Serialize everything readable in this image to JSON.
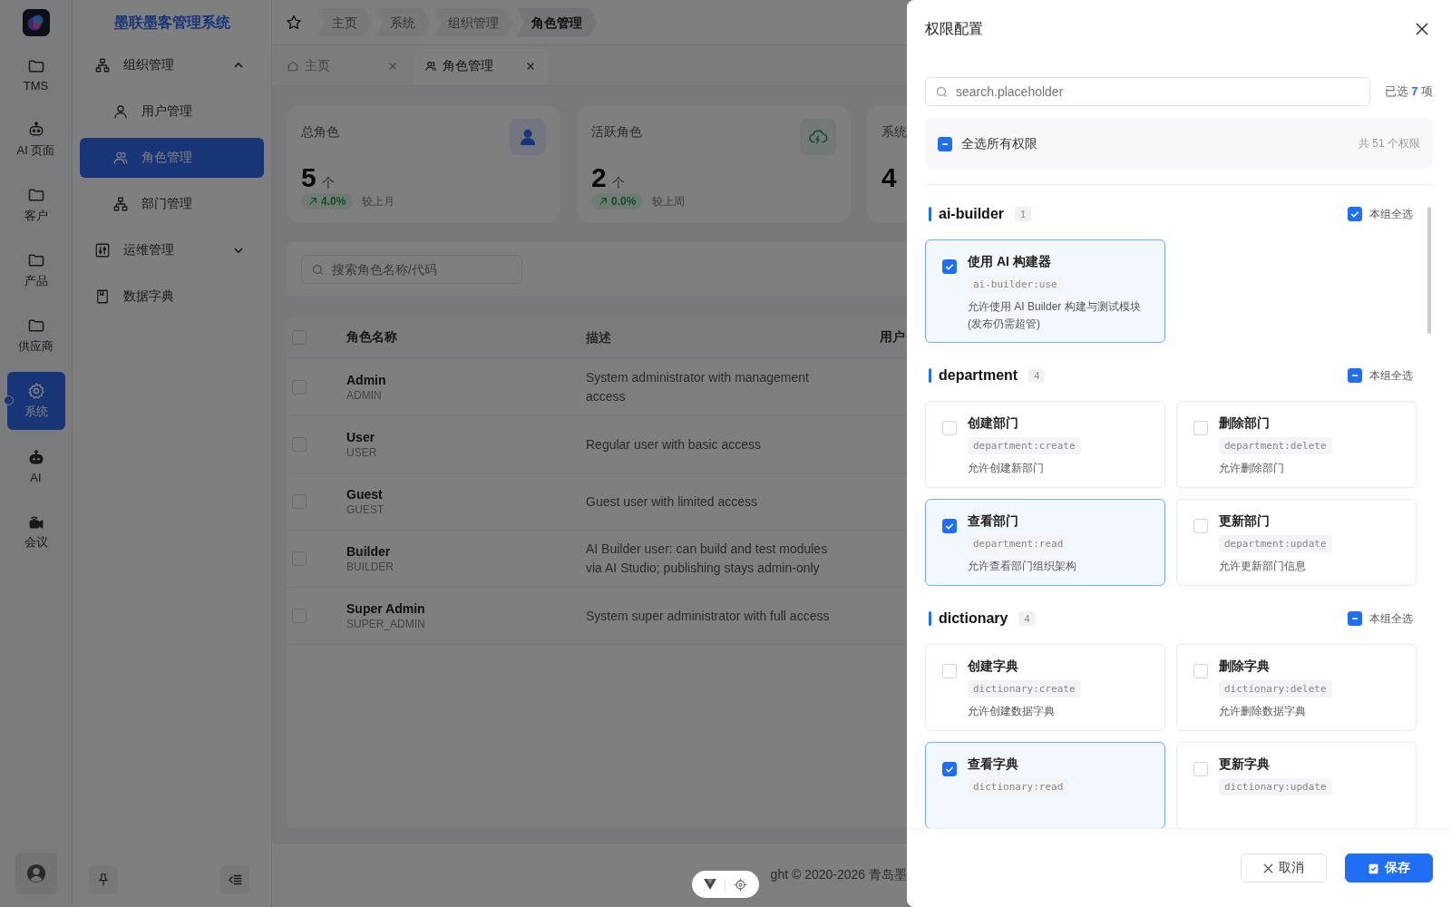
{
  "rail": {
    "items": [
      {
        "label": "TMS",
        "selected": false
      },
      {
        "label": "AI 页面",
        "selected": false
      },
      {
        "label": "客户",
        "selected": false
      },
      {
        "label": "产品",
        "selected": false
      },
      {
        "label": "供应商",
        "selected": false
      },
      {
        "label": "系统",
        "selected": true
      },
      {
        "label": "AI",
        "selected": false
      },
      {
        "label": "会议",
        "selected": false
      }
    ]
  },
  "sidebar": {
    "title": "墨联墨客管理系统",
    "items": [
      {
        "label": "组织管理",
        "selected": false,
        "expanded": true,
        "children": [
          {
            "label": "用户管理",
            "selected": false
          },
          {
            "label": "角色管理",
            "selected": true
          },
          {
            "label": "部门管理",
            "selected": false
          }
        ]
      },
      {
        "label": "运维管理",
        "selected": false,
        "expanded": false
      },
      {
        "label": "数据字典",
        "selected": false
      }
    ]
  },
  "breadcrumb": [
    {
      "label": "主页",
      "current": false
    },
    {
      "label": "系统",
      "current": false
    },
    {
      "label": "组织管理",
      "current": false
    },
    {
      "label": "角色管理",
      "current": true
    }
  ],
  "tabs": [
    {
      "label": "主页",
      "selected": false
    },
    {
      "label": "角色管理",
      "selected": true
    }
  ],
  "stats": [
    {
      "title": "总角色",
      "value": "5",
      "unit": "个",
      "change": "4.0%",
      "compare": "较上月"
    },
    {
      "title": "活跃角色",
      "value": "2",
      "unit": "个",
      "change": "0.0%",
      "compare": "较上周"
    },
    {
      "title": "系统",
      "value": "4"
    }
  ],
  "search": {
    "placeholder": "搜索角色名称/代码"
  },
  "table": {
    "all_selected": false,
    "columns": [
      "角色名称",
      "描述",
      "用户"
    ],
    "rows": [
      {
        "name": "Admin",
        "code": "ADMIN",
        "description": "System administrator with management access",
        "selected": false
      },
      {
        "name": "User",
        "code": "USER",
        "description": "Regular user with basic access",
        "selected": false
      },
      {
        "name": "Guest",
        "code": "GUEST",
        "description": "Guest user with limited access",
        "selected": false
      },
      {
        "name": "Builder",
        "code": "BUILDER",
        "description": "AI Builder user: can build and test modules via AI Studio; publishing stays admin-only",
        "selected": false
      },
      {
        "name": "Super Admin",
        "code": "SUPER_ADMIN",
        "description": "System super administrator with full access",
        "selected": false
      }
    ]
  },
  "footer": {
    "text": "ght © 2020-2026 青岛墨"
  },
  "drawer": {
    "title": "权限配置",
    "search": {
      "placeholder": "search.placeholder"
    },
    "selected_count": "已选 **7** 项",
    "select_all": {
      "label": "全选所有权限",
      "checked": true,
      "indeterminate": true,
      "total": "共 51 个权限"
    },
    "groups": [
      {
        "name": "ai-builder",
        "count": "1",
        "select_label": "本组全选",
        "checked": true,
        "indeterminate": false,
        "permissions": [
          {
            "title": "使用 AI 构建器",
            "code": "ai-builder:use",
            "desc": "允许使用 AI Builder 构建与测试模块(发布仍需超管)",
            "checked": true
          }
        ]
      },
      {
        "name": "department",
        "count": "4",
        "select_label": "本组全选",
        "checked": true,
        "indeterminate": true,
        "permissions": [
          {
            "title": "创建部门",
            "code": "department:create",
            "desc": "允许创建新部门",
            "checked": false
          },
          {
            "title": "删除部门",
            "code": "department:delete",
            "desc": "允许删除部门",
            "checked": false
          },
          {
            "title": "查看部门",
            "code": "department:read",
            "desc": "允许查看部门组织架构",
            "checked": true
          },
          {
            "title": "更新部门",
            "code": "department:update",
            "desc": "允许更新部门信息",
            "checked": false
          }
        ]
      },
      {
        "name": "dictionary",
        "count": "4",
        "select_label": "本组全选",
        "checked": true,
        "indeterminate": true,
        "permissions": [
          {
            "title": "创建字典",
            "code": "dictionary:create",
            "desc": "允许创建数据字典",
            "checked": false
          },
          {
            "title": "删除字典",
            "code": "dictionary:delete",
            "desc": "允许删除数据字典",
            "checked": false
          },
          {
            "title": "查看字典",
            "code": "dictionary:read",
            "checked": true
          },
          {
            "title": "更新字典",
            "code": "dictionary:update",
            "checked": false
          }
        ]
      }
    ],
    "buttons": {
      "cancel": "取消",
      "save": "保存"
    }
  }
}
